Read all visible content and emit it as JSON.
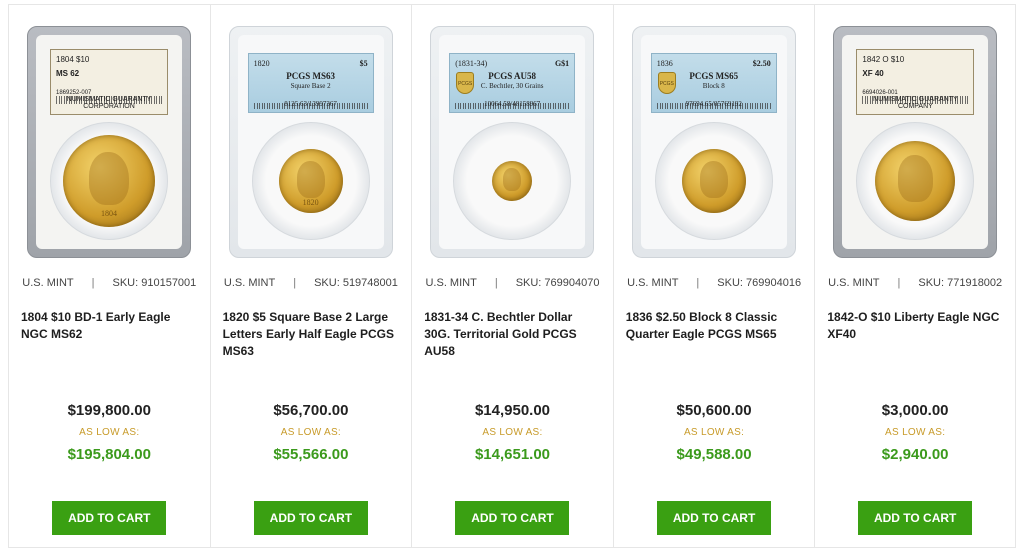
{
  "products": [
    {
      "slab_type": "ngc",
      "label": {
        "line1": "1804 $10",
        "line1_right": "",
        "grade": "MS 62",
        "line3": "1869252-007",
        "footer": "NUMISMATIC GUARANTY CORPORATION"
      },
      "coin_size": "xl",
      "coin_digits": "1804",
      "mint": "U.S. MINT",
      "sku": "SKU: 910157001",
      "title": "1804 $10 BD-1 Early Eagle NGC MS62",
      "price": "$199,800.00",
      "low_label": "AS LOW AS:",
      "low_price": "$195,804.00",
      "button": "ADD TO CART"
    },
    {
      "slab_type": "pcgs",
      "label": {
        "line1": "1820",
        "line1_right": "$5",
        "grade": "PCGS MS63",
        "line3": "Square Base 2",
        "footer": "8125.63/13997367"
      },
      "coin_size": "md",
      "coin_digits": "1820",
      "mint": "U.S. MINT",
      "sku": "SKU: 519748001",
      "title": "1820 $5 Square Base 2 Large Letters Early Half Eagle PCGS MS63",
      "price": "$56,700.00",
      "low_label": "AS LOW AS:",
      "low_price": "$55,566.00",
      "button": "ADD TO CART"
    },
    {
      "slab_type": "pcgs",
      "label": {
        "line1": "(1831-34)",
        "line1_right": "G$1",
        "grade": "PCGS AU58",
        "line3": "C. Bechtler, 30 Grains",
        "footer": "10064.58/48158967"
      },
      "shield": "PCGS",
      "coin_size": "sm",
      "coin_digits": "",
      "mint": "U.S. MINT",
      "sku": "SKU: 769904070",
      "title": "1831-34 C. Bechtler Dollar 30G. Territorial Gold PCGS AU58",
      "price": "$14,950.00",
      "low_label": "AS LOW AS:",
      "low_price": "$14,651.00",
      "button": "ADD TO CART"
    },
    {
      "slab_type": "pcgs",
      "label": {
        "line1": "1836",
        "line1_right": "$2.50",
        "grade": "PCGS MS65",
        "line3": "Block 8",
        "footer": "97694.65/05769192"
      },
      "shield": "PCGS",
      "coin_size": "md",
      "coin_digits": "",
      "mint": "U.S. MINT",
      "sku": "SKU: 769904016",
      "title": "1836 $2.50 Block 8 Classic Quarter Eagle PCGS MS65",
      "price": "$50,600.00",
      "low_label": "AS LOW AS:",
      "low_price": "$49,588.00",
      "button": "ADD TO CART"
    },
    {
      "slab_type": "ngc",
      "label": {
        "line1": "1842 O $10",
        "line1_right": "",
        "grade": "XF 40",
        "line3": "6694026-001",
        "footer": "NUMISMATIC GUARANTY COMPANY"
      },
      "coin_size": "lg",
      "coin_digits": "",
      "mint": "U.S. MINT",
      "sku": "SKU: 771918002",
      "title": "1842-O $10 Liberty Eagle NGC XF40",
      "price": "$3,000.00",
      "low_label": "AS LOW AS:",
      "low_price": "$2,940.00",
      "button": "ADD TO CART"
    }
  ],
  "colors": {
    "accent_green": "#3aa012",
    "price_green": "#3b9a1c",
    "low_label_gold": "#c89b2a"
  }
}
